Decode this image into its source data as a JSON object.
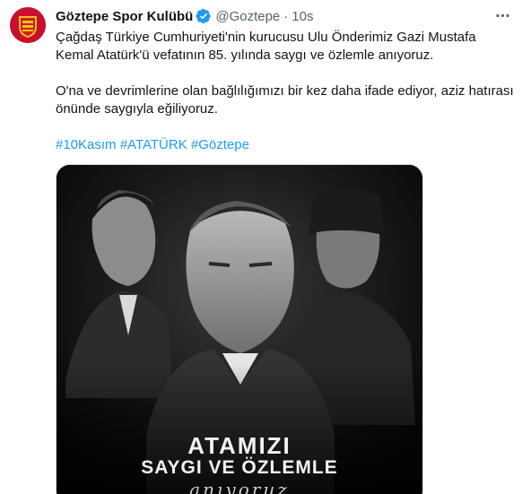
{
  "tweet": {
    "author_name": "Göztepe Spor Kulübü",
    "handle": "@Goztepe",
    "separator": "·",
    "timestamp": "10s",
    "paragraph1_line1": "Çağdaş Türkiye Cumhuriyeti'nin kurucusu Ulu Önderimiz Gazi Mustafa",
    "paragraph1_line2": "Kemal Atatürk'ü vefatının 85. yılında saygı ve özlemle anıyoruz.",
    "paragraph2_line1": "O'na ve devrimlerine olan bağlılığımızı bir kez daha ifade ediyor, aziz hatırası",
    "paragraph2_line2": "önünde saygıyla eğiliyoruz.",
    "hashtags": [
      "#10Kasım",
      "#ATATÜRK",
      "#Göztepe"
    ]
  },
  "media": {
    "caption_line1": "ATAMIZI",
    "caption_line2": "SAYGI VE ÖZLEMLE",
    "caption_line3": "anıyoruz"
  },
  "icons": {
    "avatar": "goztepe-logo",
    "verified": "verified-badge-icon",
    "more": "more-icon"
  },
  "colors": {
    "link": "#1d9bf0",
    "secondary_text": "#536471",
    "brand": "#c8102e"
  }
}
